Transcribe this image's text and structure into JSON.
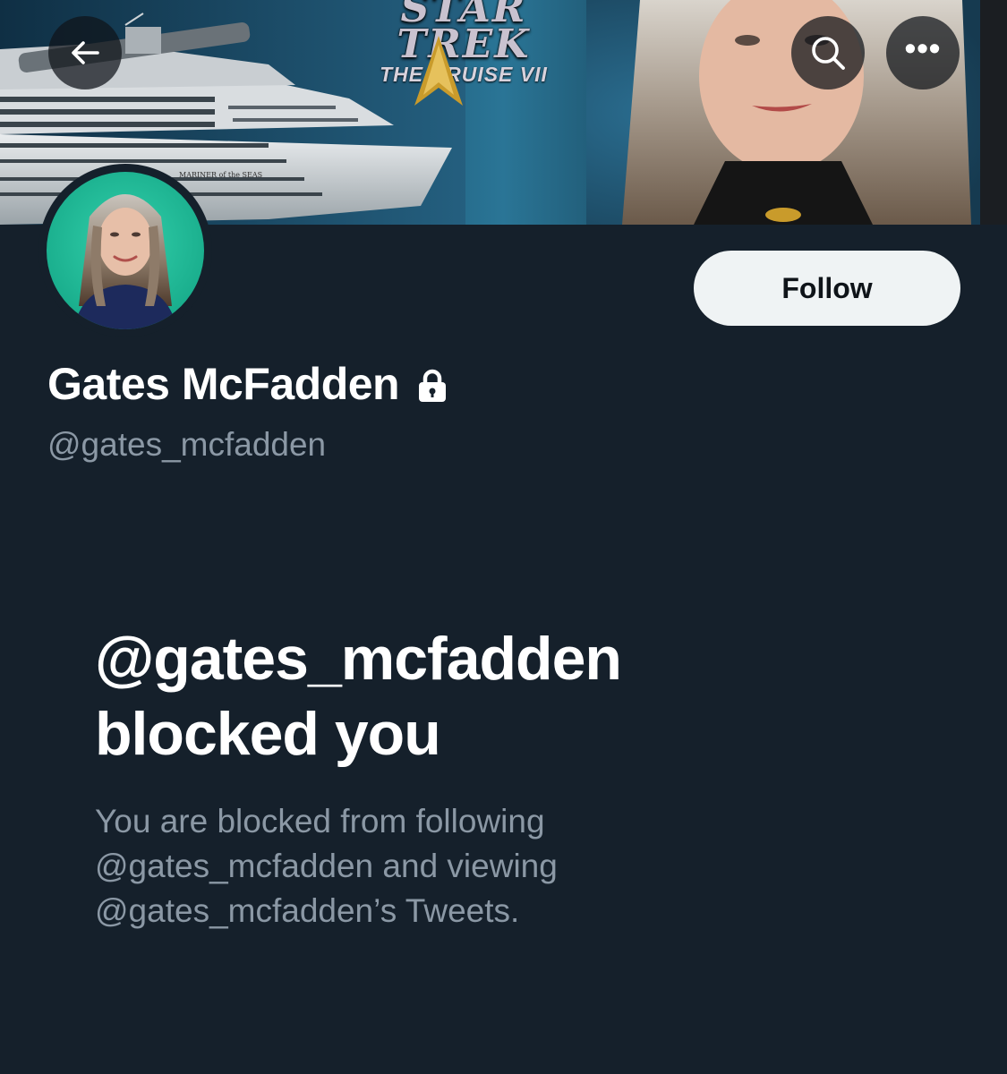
{
  "banner": {
    "logo_text": "STAR TREK",
    "subtitle": "THE CRUISE VII",
    "ship_name": "MARINER of the SEAS"
  },
  "toolbar": {
    "back_icon": "arrow-left-icon",
    "search_icon": "search-icon",
    "more_icon": "more-horizontal-icon",
    "more_label": "•••"
  },
  "profile": {
    "display_name": "Gates McFadden",
    "protected_icon": "lock-icon",
    "handle": "@gates_mcfadden",
    "follow_label": "Follow"
  },
  "blocked": {
    "title_line1": "@gates_mcfadden",
    "title_line2": "blocked you",
    "description_line1": "You are blocked from following",
    "description_line2": "@gates_mcfadden and viewing",
    "description_line3": "@gates_mcfadden’s Tweets."
  },
  "colors": {
    "background": "#15202b",
    "secondary_text": "#8b98a5",
    "follow_button_bg": "#eff3f4",
    "avatar_bg": "#1fbf9a"
  }
}
